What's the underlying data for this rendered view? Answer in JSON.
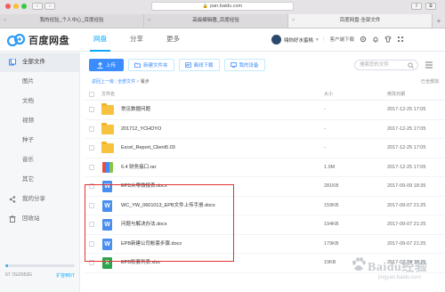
{
  "browser": {
    "url": "pan.baidu.com",
    "tabs": [
      {
        "label": "我的经验_个人中心_百度经验",
        "active": false
      },
      {
        "label": "高级编辑器_百度经验",
        "active": false
      },
      {
        "label": "百度网盘-全部文件",
        "active": true
      }
    ]
  },
  "header": {
    "logo_text": "百度网盘",
    "nav": [
      {
        "label": "网盘",
        "active": true
      },
      {
        "label": "分享",
        "active": false
      },
      {
        "label": "更多",
        "active": false
      }
    ],
    "username": "嗨你好水蜜桃",
    "client_download": "客户端下载"
  },
  "sidebar": {
    "items": [
      {
        "label": "全部文件",
        "icon": "files-icon",
        "active": true
      },
      {
        "label": "图片",
        "active": false
      },
      {
        "label": "文档",
        "active": false
      },
      {
        "label": "视频",
        "active": false
      },
      {
        "label": "种子",
        "active": false
      },
      {
        "label": "音乐",
        "active": false
      },
      {
        "label": "其它",
        "active": false
      },
      {
        "label": "我的分享",
        "icon": "share-icon",
        "active": false
      },
      {
        "label": "回收站",
        "icon": "trash-icon",
        "active": false
      }
    ],
    "quota_text": "67.7G/2053G",
    "quota_fraction": 0.033,
    "expand_label": "扩容到5T"
  },
  "toolbar": {
    "upload": "上传",
    "new_folder": "新建文件夹",
    "offline_download": "离线下载",
    "my_devices": "我的设备",
    "search_placeholder": "搜索您的文件"
  },
  "breadcrumb": {
    "back": "返回上一级",
    "sep1": "|",
    "root": "全部文件",
    "sep2": ">",
    "current": "餐步"
  },
  "loaded_text": "已全部加",
  "table": {
    "headers": {
      "name": "文件名",
      "size": "大小",
      "date": "修改日期"
    },
    "rows": [
      {
        "name": "常见数据问题",
        "size": "-",
        "date": "2017-12-25 17:05",
        "type": "folder"
      },
      {
        "name": "201712_YCHOYO",
        "size": "-",
        "date": "2017-12-25 17:05",
        "type": "folder"
      },
      {
        "name": "Excel_Report_Client5.03",
        "size": "-",
        "date": "2017-12-25 17:05",
        "type": "folder"
      },
      {
        "name": "6.4 财务接口.rar",
        "size": "1.9M",
        "date": "2017-12-25 17:05",
        "type": "rar"
      },
      {
        "name": "EPB从零做报表.docx",
        "size": "281KB",
        "date": "2017-09-09 18:35",
        "type": "doc"
      },
      {
        "name": "WC_YW_0601013_EPB文件上传手册.docx",
        "size": "159KB",
        "date": "2017-09-07 21:25",
        "type": "doc"
      },
      {
        "name": "问题与解决办法.docx",
        "size": "194KB",
        "date": "2017-09-07 21:25",
        "type": "doc"
      },
      {
        "name": "EPB新建公司帐套步骤.docx",
        "size": "179KB",
        "date": "2017-09-07 21:25",
        "type": "doc"
      },
      {
        "name": "EPB账套列表.xlsx",
        "size": "19KB",
        "date": "2017-02-24 16:10",
        "type": "xls"
      }
    ]
  },
  "watermark": {
    "text": "Baidu经验",
    "sub": "jingyan.baidu.com"
  },
  "colors": {
    "accent": "#09aaff",
    "button_blue": "#3b8cff",
    "highlight": "#e0322f"
  }
}
